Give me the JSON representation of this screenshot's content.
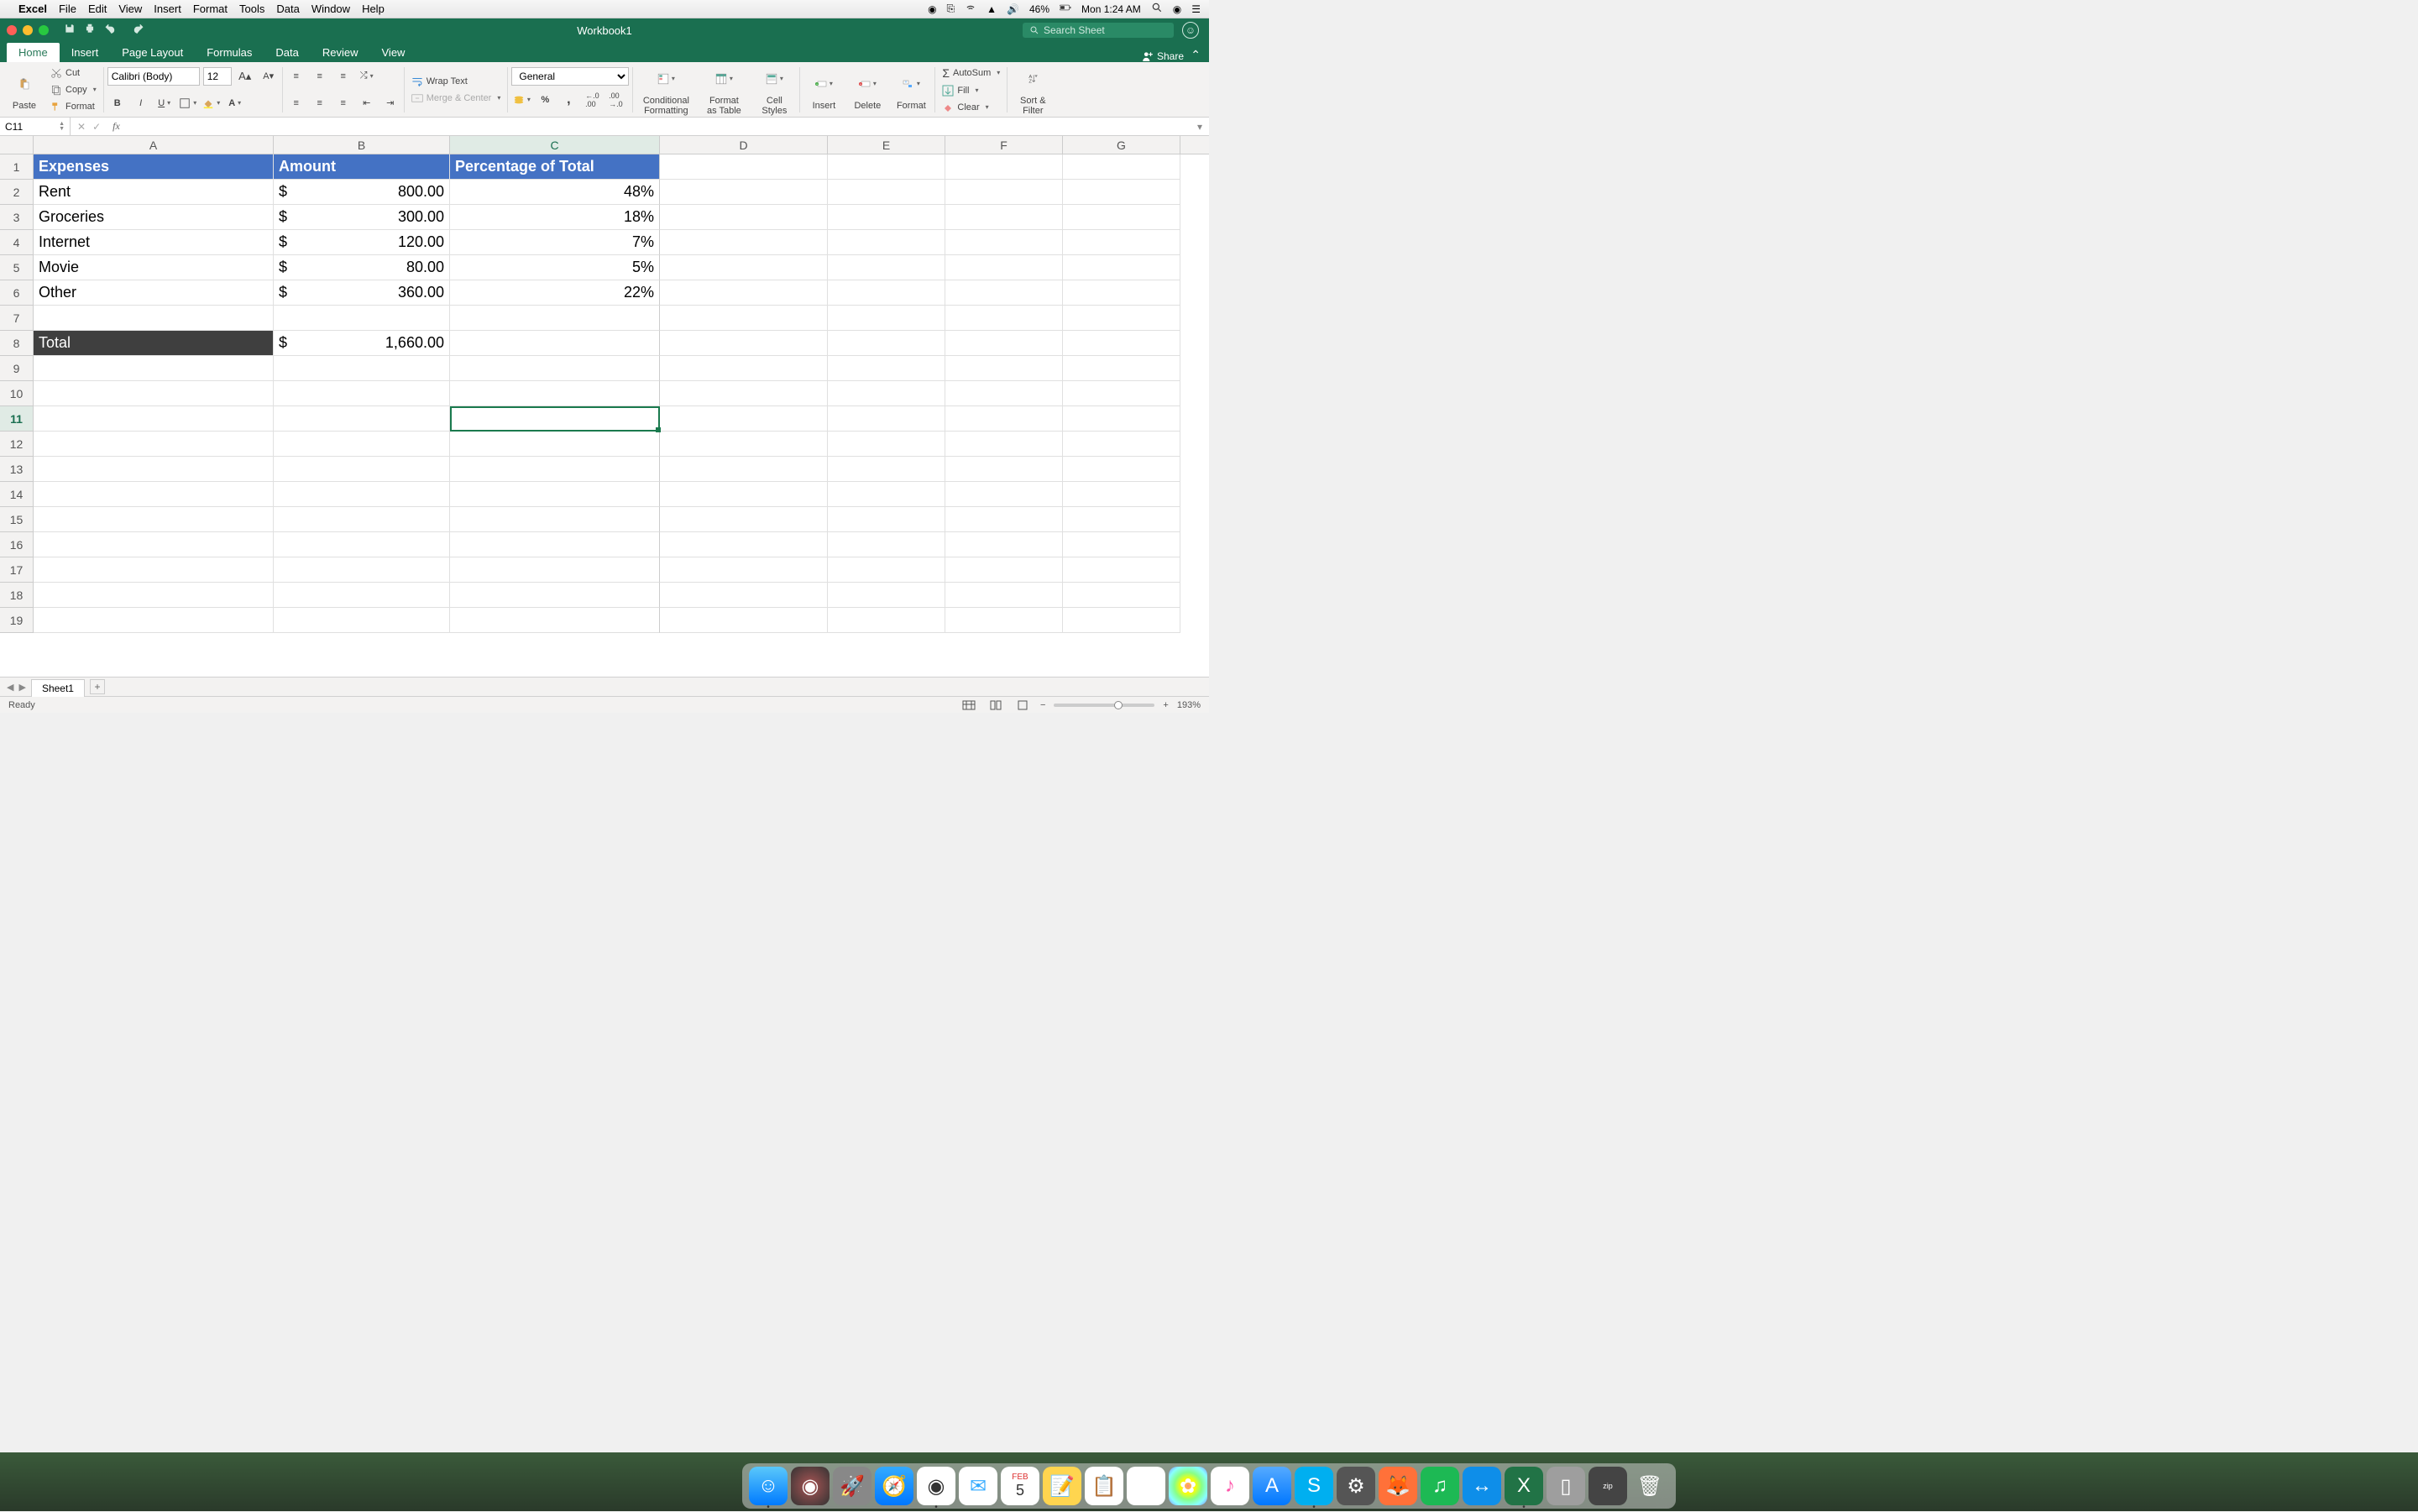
{
  "mac_menu": {
    "app": "Excel",
    "items": [
      "File",
      "Edit",
      "View",
      "Insert",
      "Format",
      "Tools",
      "Data",
      "Window",
      "Help"
    ],
    "battery": "46%",
    "clock": "Mon 1:24 AM"
  },
  "window": {
    "title": "Workbook1",
    "search_placeholder": "Search Sheet"
  },
  "tabs": [
    "Home",
    "Insert",
    "Page Layout",
    "Formulas",
    "Data",
    "Review",
    "View"
  ],
  "active_tab": "Home",
  "share": "Share",
  "ribbon": {
    "paste": "Paste",
    "cut": "Cut",
    "copy": "Copy",
    "format_painter": "Format",
    "font_name": "Calibri (Body)",
    "font_size": "12",
    "wrap_text": "Wrap Text",
    "merge_center": "Merge & Center",
    "number_format": "General",
    "cond_fmt": "Conditional Formatting",
    "fmt_table": "Format as Table",
    "cell_styles": "Cell Styles",
    "insert": "Insert",
    "delete": "Delete",
    "format": "Format",
    "autosum": "AutoSum",
    "fill": "Fill",
    "clear": "Clear",
    "sort_filter": "Sort & Filter"
  },
  "formula_bar": {
    "cell_ref": "C11",
    "formula": ""
  },
  "columns": [
    "A",
    "B",
    "C",
    "D",
    "E",
    "F",
    "G"
  ],
  "active_col": "C",
  "active_row": 11,
  "sheet_data": {
    "headers": [
      "Expenses",
      "Amount",
      "Percentage of Total"
    ],
    "rows": [
      {
        "label": "Rent",
        "amount": "800.00",
        "pct": "48%"
      },
      {
        "label": "Groceries",
        "amount": "300.00",
        "pct": "18%"
      },
      {
        "label": "Internet",
        "amount": "120.00",
        "pct": "7%"
      },
      {
        "label": "Movie",
        "amount": "80.00",
        "pct": "5%"
      },
      {
        "label": "Other",
        "amount": "360.00",
        "pct": "22%"
      }
    ],
    "total_label": "Total",
    "total_amount": "1,660.00",
    "currency": "$"
  },
  "sheet_tab": "Sheet1",
  "status": {
    "ready": "Ready",
    "zoom": "193%"
  },
  "dock_apps": [
    "finder",
    "siri",
    "launchpad",
    "safari",
    "chrome",
    "mail",
    "calendar",
    "notes",
    "reminders",
    "maps",
    "photos",
    "itunes",
    "appstore",
    "skype",
    "settings",
    "firefox",
    "spotify",
    "teamviewer",
    "excel",
    "word",
    "editor",
    "trash"
  ]
}
